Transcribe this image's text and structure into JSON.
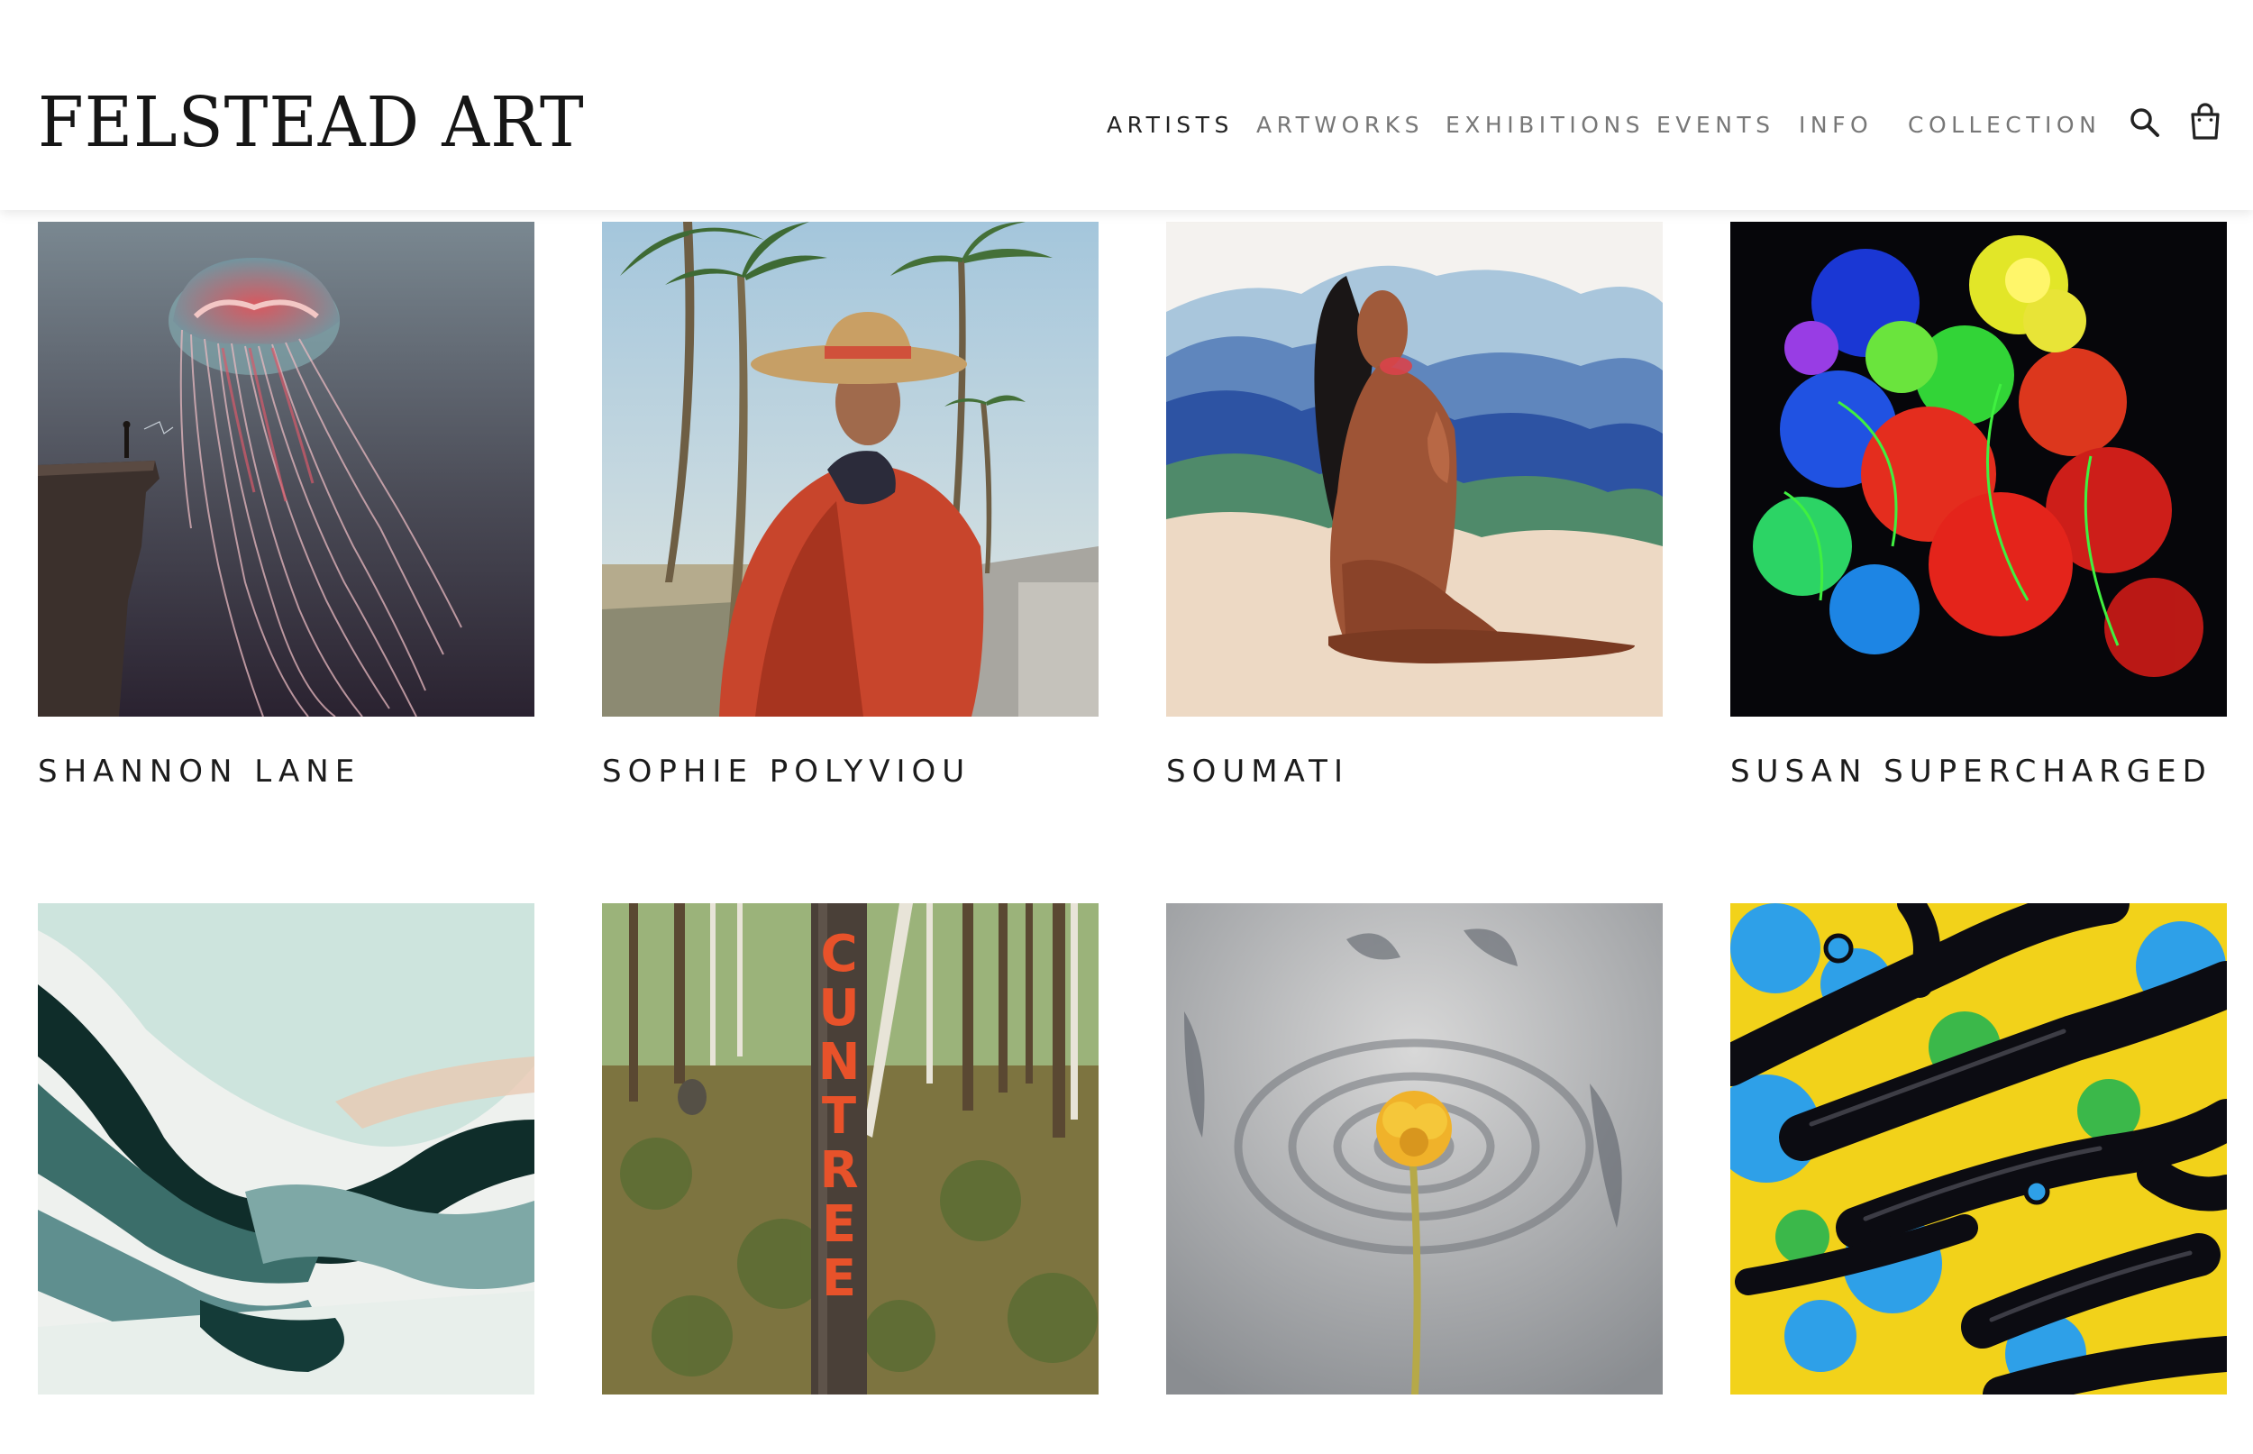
{
  "site": {
    "logo": "FELSTEAD ART"
  },
  "nav": [
    {
      "label": "ARTISTS",
      "active": true
    },
    {
      "label": "ARTWORKS"
    },
    {
      "label": "EXHIBITIONS"
    },
    {
      "label": "EVENTS"
    },
    {
      "label": "INFO"
    },
    {
      "label": "COLLECTION"
    }
  ],
  "header_icons": [
    "search-icon",
    "shopping-bag-icon"
  ],
  "artists": [
    {
      "name": "SHANNON LANE",
      "artwork": "jellyfish-over-cliff"
    },
    {
      "name": "SOPHIE POLYVIOU",
      "artwork": "woman-in-hat-with-palms"
    },
    {
      "name": "SOUMATI",
      "artwork": "seated-figure-with-mountains"
    },
    {
      "name": "SUSAN SUPERCHARGED",
      "artwork": "neon-flower-bouquet"
    },
    {
      "name": "",
      "artwork": "teal-abstract-landscape"
    },
    {
      "name": "",
      "artwork": "forest-with-cuntree-trunk",
      "painted_text": "CUNTREE"
    },
    {
      "name": "",
      "artwork": "yellow-flower-in-water-ripple"
    },
    {
      "name": "",
      "artwork": "fluid-pour-abstract"
    }
  ],
  "colors": {
    "text": "#1c1c1c",
    "nav_inactive": "#777777",
    "background": "#ffffff"
  }
}
